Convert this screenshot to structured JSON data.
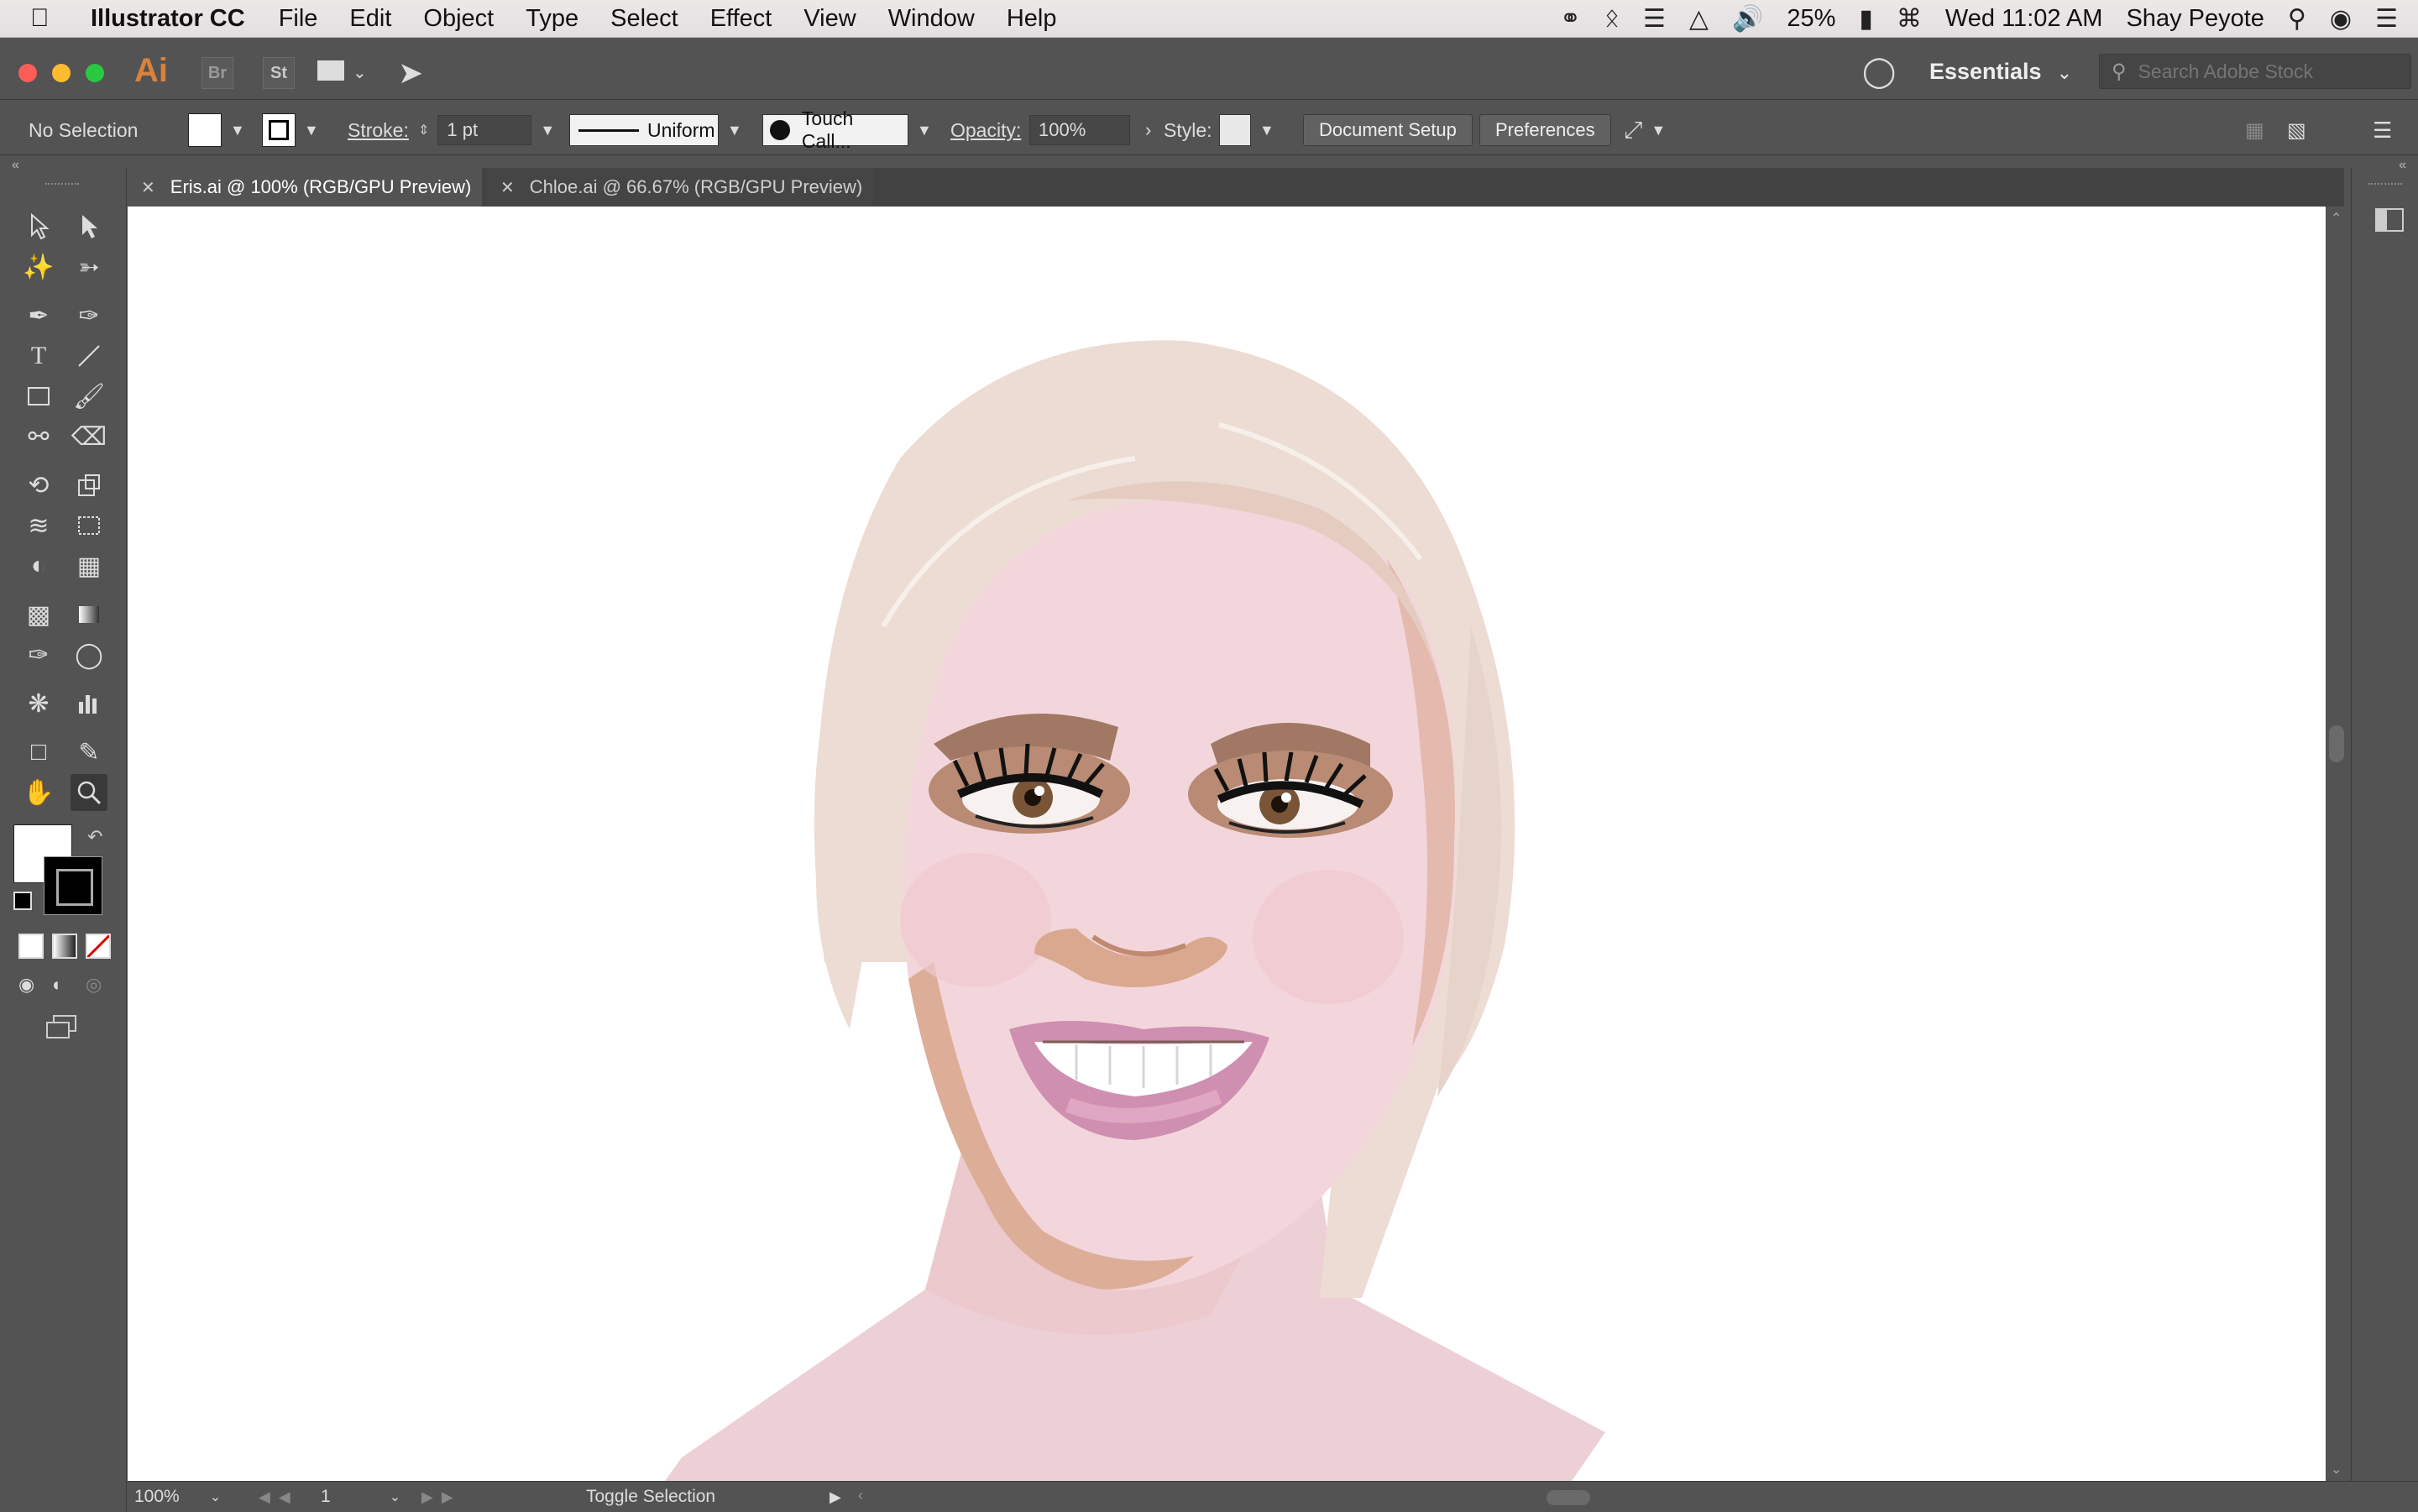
{
  "menubar": {
    "app_name": "Illustrator CC",
    "items": [
      "File",
      "Edit",
      "Object",
      "Type",
      "Select",
      "Effect",
      "View",
      "Window",
      "Help"
    ],
    "battery": "25%",
    "clock": "Wed 11:02 AM",
    "user": "Shay Peyote"
  },
  "appbar": {
    "logo": "Ai",
    "bridge": "Br",
    "stock": "St",
    "workspace": "Essentials",
    "search_placeholder": "Search Adobe Stock"
  },
  "controlbar": {
    "selection": "No Selection",
    "stroke_label": "Stroke:",
    "stroke_value": "1 pt",
    "stroke_profile": "Uniform",
    "brush": "Touch Call...",
    "opacity_label": "Opacity:",
    "opacity_value": "100%",
    "style_label": "Style:",
    "document_setup": "Document Setup",
    "preferences": "Preferences"
  },
  "tabs": [
    {
      "label": "Eris.ai @ 100% (RGB/GPU Preview)",
      "active": true
    },
    {
      "label": "Chloe.ai @ 66.67% (RGB/GPU Preview)",
      "active": false
    }
  ],
  "statusbar": {
    "zoom": "100%",
    "artboard": "1",
    "status": "Toggle Selection"
  },
  "colors": {
    "fill": "#ffffff",
    "stroke": "#000000",
    "hair": "#ecdcd4",
    "skin": "#f1d5d9",
    "skin_shadow": "#dcae98"
  }
}
